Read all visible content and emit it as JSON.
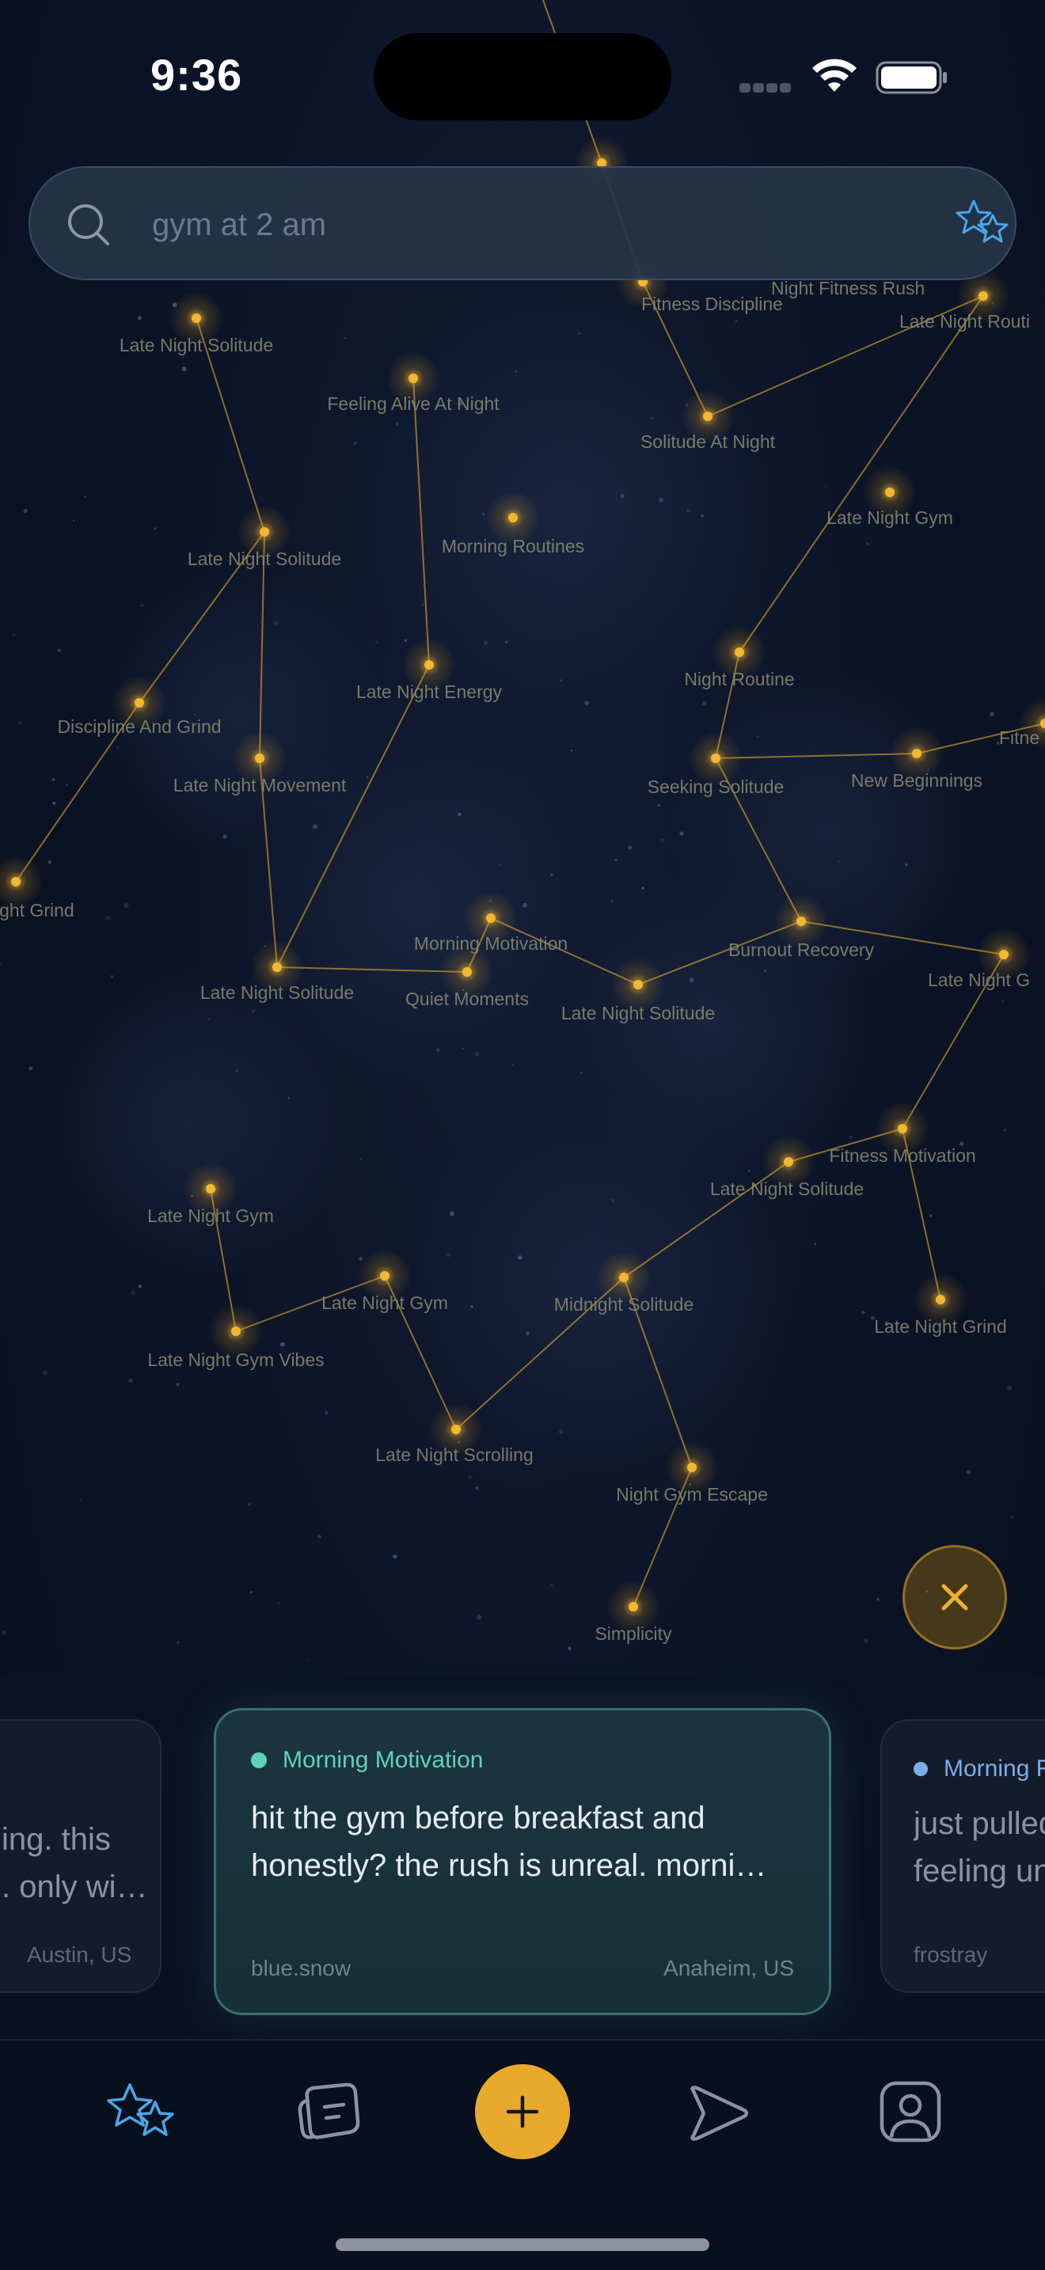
{
  "status": {
    "time": "9:36"
  },
  "search": {
    "placeholder": "gym at 2 am",
    "value": ""
  },
  "constellation": {
    "star_color": "#f2b830",
    "label_color": "#8b8b72",
    "labels": [
      "Fitness Discipline",
      "Night Fitness Rush",
      "Late Night Routi",
      "Late Night Solitude",
      "Feeling Alive At Night",
      "Solitude At Night",
      "Late Night Gym",
      "Late Night Solitude",
      "Morning Routines",
      "Night Routine",
      "Late Night Energy",
      "Discipline And Grind",
      "Fitne",
      "Late Night Movement",
      "Seeking Solitude",
      "New Beginnings",
      "ight Grind",
      "Morning Motivation",
      "Burnout Recovery",
      "Late Night Solitude",
      "Quiet Moments",
      "Late Night Solitude",
      "Late Night G",
      "Fitness Motivation",
      "Late Night Solitude",
      "Late Night Gym",
      "Late Night Gym",
      "Midnight Solitude",
      "Late Night Grind",
      "Late Night Gym Vibes",
      "Late Night Scrolling",
      "Night Gym Escape",
      "Simplicity"
    ]
  },
  "close_button": {
    "icon": "close-icon"
  },
  "cards": [
    {
      "topic": "",
      "body_line1": "ing. this",
      "body_line2": ". only wi…",
      "author": "",
      "location": "Austin, US"
    },
    {
      "topic": "Morning Motivation",
      "topic_color": "#5fd3b8",
      "body_line1": "hit the gym before breakfast and",
      "body_line2": "honestly? the rush is unreal. morni…",
      "author": "blue.snow",
      "location": "Anaheim, US"
    },
    {
      "topic": "Morning R",
      "topic_color": "#7aaee8",
      "body_line1": "just pulled",
      "body_line2": "feeling un",
      "author": "frostray",
      "location": ""
    }
  ],
  "tabbar": {
    "items": [
      "constellation-tab",
      "posts-tab",
      "add-button",
      "send-tab",
      "profile-tab"
    ],
    "active": "constellation-tab",
    "accent": "#4aa6e8",
    "add_color": "#e9aa2b"
  }
}
